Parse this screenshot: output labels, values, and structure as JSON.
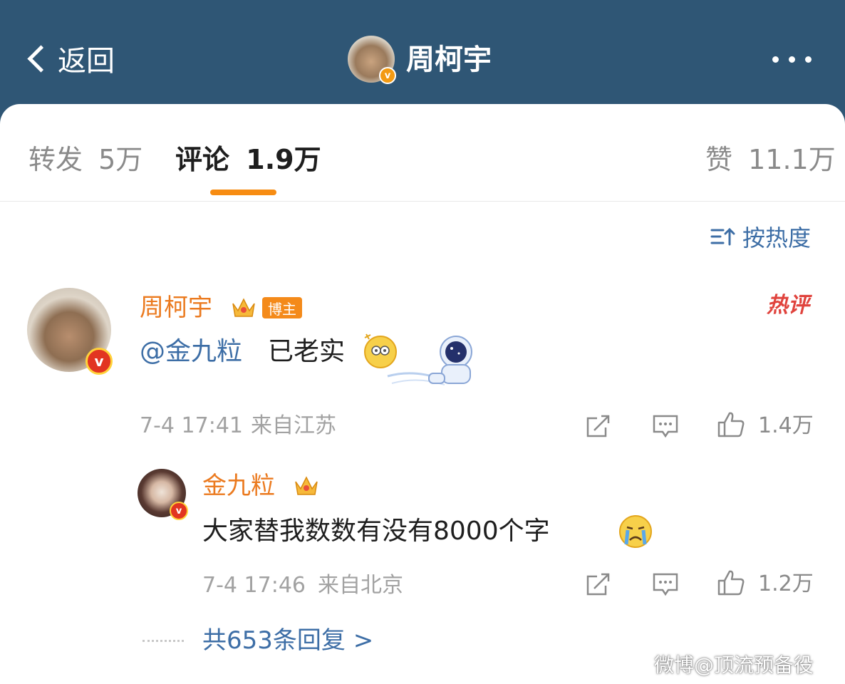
{
  "header": {
    "back_label": "返回",
    "title": "周柯宇",
    "badge": "v"
  },
  "tabs": [
    {
      "label": "转发",
      "count": "5万"
    },
    {
      "label": "评论",
      "count": "1.9万",
      "active": true
    },
    {
      "label": "赞",
      "count": "11.1万"
    }
  ],
  "sort": {
    "label": "按热度"
  },
  "comment": {
    "author": "周柯宇",
    "author_badge": "v",
    "tag": "博主",
    "hot_label": "热评",
    "mention": "@金九粒",
    "text": "已老实",
    "emoji": "dizzy-face-emoji",
    "sticker": "astronaut-sticker",
    "time": "7-4 17:41",
    "location": "来自江苏",
    "likes": "1.4万"
  },
  "reply": {
    "author": "金九粒",
    "author_badge": "v",
    "text": "大家替我数数有没有8000个字",
    "emoji": "crying-face-emoji",
    "time": "7-4 17:46",
    "location": "来自北京",
    "likes": "1.2万"
  },
  "more_replies": "共653条回复 >",
  "watermark": "微博@顶流预备役",
  "colors": {
    "header_bg": "#2f5675",
    "accent_orange": "#f78c12",
    "link_blue": "#3d6ea6",
    "name_orange": "#eb7a1f",
    "hot_red": "#e0433d"
  }
}
